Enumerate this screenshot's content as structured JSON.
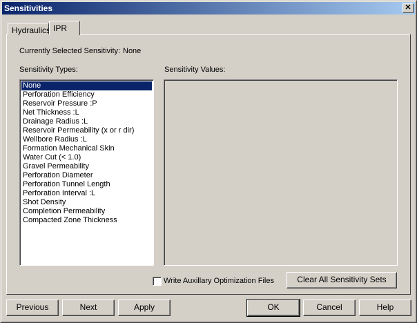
{
  "window": {
    "title": "Sensitivities",
    "close": "✕"
  },
  "tabs": [
    {
      "label": "Hydraulics"
    },
    {
      "label": "IPR",
      "active": true
    }
  ],
  "current": {
    "label": "Currently Selected Sensitivity:",
    "value": "None"
  },
  "types_label": "Sensitivity Types:",
  "values_label": "Sensitivity Values:",
  "types": [
    "None",
    "Perforation Efficiency",
    "Reservoir Pressure :P",
    "Net Thickness :L",
    "Drainage Radius :L",
    "Reservoir Permeability (x or r dir)",
    "Wellbore Radius :L",
    "Formation Mechanical Skin",
    "Water Cut (< 1.0)",
    "Gravel Permeability",
    "Perforation Diameter",
    "Perforation Tunnel Length",
    "Perforation Interval :L",
    "Shot Density",
    "Completion Permeability",
    "Compacted Zone Thickness"
  ],
  "selected_type": "None",
  "checkbox": {
    "label": "Write Auxillary Optimization Files",
    "checked": false
  },
  "buttons": {
    "clear": "Clear All Sensitivity Sets",
    "previous": "Previous",
    "next": "Next",
    "apply": "Apply",
    "ok": "OK",
    "cancel": "Cancel",
    "help": "Help"
  }
}
